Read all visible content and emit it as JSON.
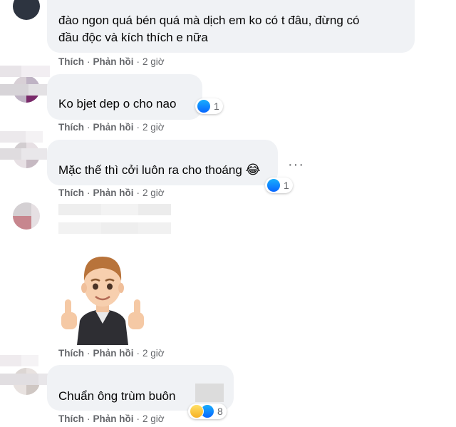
{
  "comments": [
    {
      "text_line1": "đào ngon quá bén quá mà dịch em ko có t đâu, đừng có",
      "text_line2": "đầu độc và kích thích e nữa",
      "like_label": "Thích",
      "reply_label": "Phản hồi",
      "time": "2 giờ"
    },
    {
      "text": "Ko bjet dep o cho nao",
      "like_label": "Thích",
      "reply_label": "Phản hồi",
      "time": "2 giờ",
      "reaction_count": "1",
      "reaction_icons": [
        "like-icon"
      ]
    },
    {
      "text": "Mặc thế thì cởi luôn ra cho thoáng",
      "emoji": "😂",
      "like_label": "Thích",
      "reply_label": "Phản hồi",
      "time": "2 giờ",
      "reaction_count": "1",
      "reaction_icons": [
        "like-icon"
      ]
    },
    {
      "sticker": "avatar-thumbs-up-sticker",
      "like_label": "Thích",
      "reply_label": "Phản hồi",
      "time": "2 giờ"
    },
    {
      "text": "Chuẩn ông trùm buôn",
      "like_label": "Thích",
      "reply_label": "Phản hồi",
      "time": "2 giờ",
      "reaction_count": "8",
      "reaction_icons": [
        "haha-icon",
        "like-icon"
      ]
    }
  ],
  "colors": {
    "bubble": "#f0f2f5",
    "meta_text": "#65676b",
    "like_blue": "#0866ff"
  }
}
